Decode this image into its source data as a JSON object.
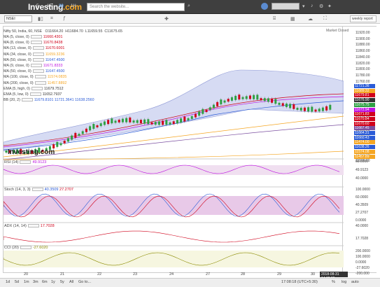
{
  "topbar": {
    "logo": "Investing",
    "logo_suffix": ".com",
    "timeframes": [
      "5",
      "15",
      "30",
      "1H",
      "5H",
      "1D",
      "1W",
      "1M"
    ],
    "active_tf": "30",
    "search_placeholder": "Search the website...",
    "report_button": "weekly report"
  },
  "symbol": {
    "code": "NSEI",
    "title": "Nifty 50, India, 60, NSE",
    "open": "O11664.20",
    "high": "H11684.70",
    "low": "L11659.55",
    "close": "C11675.65",
    "status": "Market Closed"
  },
  "indicators": [
    {
      "label": "MA (5, close, 0)",
      "value": "11660.4301",
      "color": "#d0021b"
    },
    {
      "label": "MA (8, close, 0)",
      "value": "11670.8438",
      "color": "#d0021b"
    },
    {
      "label": "MA (13, close, 0)",
      "value": "11670.6001",
      "color": "#d0021b"
    },
    {
      "label": "MA (34, close, 0)",
      "value": "11659.3236",
      "color": "#f5a623"
    },
    {
      "label": "MA (50, close, 0)",
      "value": "11647.4500",
      "color": "#2a5bd7"
    },
    {
      "label": "MA (9, close, 0)",
      "value": "11671.8333",
      "color": "#bd10e0"
    },
    {
      "label": "MA (50, close, 0)",
      "value": "11647.4500",
      "color": "#2a5bd7"
    },
    {
      "label": "MA (100, close, 0)",
      "value": "11574.0835",
      "color": "#f5a623"
    },
    {
      "label": "MA (200, close, 0)",
      "value": "11457.8892",
      "color": "#f5a623"
    },
    {
      "label": "EMA (5, high, 0)",
      "value": "11679.7512",
      "color": "#333"
    },
    {
      "label": "EMA (5, low, 0)",
      "value": "11652.7937",
      "color": "#333"
    },
    {
      "label": "BB (20, 2)",
      "value": "11679.8101  11721.3641  11638.2560",
      "color": "#2a5bd7"
    }
  ],
  "price_axis": [
    "11920.00",
    "11900.00",
    "11880.00",
    "11860.00",
    "11840.00",
    "11820.00",
    "11800.00",
    "11780.00",
    "11760.00",
    "11740.00",
    "11720.00",
    "11700.00",
    "11680.00",
    "11660.00",
    "11640.00",
    "11620.00",
    "11600.00",
    "11580.00",
    "11560.00",
    "11540.00",
    "11520.00",
    "11500.00"
  ],
  "price_badges": [
    {
      "v": "11721.36",
      "c": "#2a5bd7"
    },
    {
      "v": "11689.32",
      "c": "#f5a623"
    },
    {
      "v": "11679.81",
      "c": "#d0021b"
    },
    {
      "v": "11676.90",
      "c": "#333"
    },
    {
      "v": "11675.75",
      "c": "#2ea043"
    },
    {
      "v": "11672.94",
      "c": "#bd10e0"
    },
    {
      "v": "11671.83",
      "c": "#d0021b"
    },
    {
      "v": "11670.84",
      "c": "#d0021b"
    },
    {
      "v": "11670.60",
      "c": "#d0021b"
    },
    {
      "v": "11667.45",
      "c": "#7b4fa0"
    },
    {
      "v": "11664.31",
      "c": "#2a5bd7"
    },
    {
      "v": "11660.43",
      "c": "#2a5bd7"
    },
    {
      "v": "11474.00",
      "c": "#f5a623"
    },
    {
      "v": "11638.26",
      "c": "#2a5bd7"
    },
    {
      "v": "11574.08",
      "c": "#f5a623"
    },
    {
      "v": "11457.89",
      "c": "#f5a623"
    }
  ],
  "panes": {
    "rsi": {
      "label": "RSI (14)",
      "value": "49.9123",
      "axis": [
        "60.0000",
        "49.9123",
        "40.0000"
      ]
    },
    "stoch": {
      "label": "Stoch (14, 3, 3)",
      "v1": "40.3509",
      "v2": "27.2707",
      "axis": [
        "100.0000",
        "60.0000",
        "40.3509",
        "27.2707",
        "0.0000"
      ]
    },
    "adx": {
      "label": "ADX (14, 14)",
      "value": "17.7028",
      "axis": [
        "40.0000",
        "17.7028"
      ]
    },
    "cci": {
      "label": "CCI (20)",
      "value": "-27.6020",
      "axis": [
        "200.0000",
        "100.0000",
        "0.0000",
        "-27.6020",
        "-200.000"
      ]
    }
  },
  "xaxis": [
    "20",
    "21",
    "22",
    "23",
    "24",
    "27",
    "28",
    "29",
    "30",
    "31"
  ],
  "date_pill": "2018-08-31 14:30:00",
  "footer": {
    "ranges": [
      "1d",
      "5d",
      "1m",
      "3m",
      "6m",
      "1y",
      "5y",
      "All",
      "Go to..."
    ],
    "clock": "17:08:18 (UTC+5:30)",
    "opts": [
      "%",
      "log",
      "auto"
    ]
  }
}
